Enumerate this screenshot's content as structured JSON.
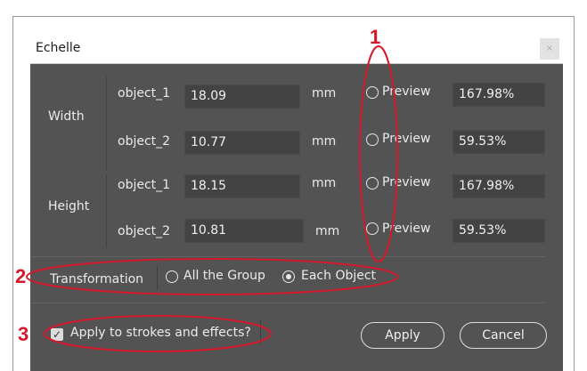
{
  "dialog": {
    "title": "Echelle",
    "close_glyph": "×"
  },
  "width_group": {
    "label": "Width",
    "rows": [
      {
        "object": "object_1",
        "value": "18.09",
        "unit": "mm",
        "preview": "Preview",
        "percent": "167.98%"
      },
      {
        "object": "object_2",
        "value": "10.77",
        "unit": "mm",
        "preview": "Preview",
        "percent": "59.53%"
      }
    ]
  },
  "height_group": {
    "label": "Height",
    "rows": [
      {
        "object": "object_1",
        "value": "18.15",
        "unit": "mm",
        "preview": "Preview",
        "percent": "167.98%"
      },
      {
        "object": "object_2",
        "value": "10.81",
        "unit": "mm",
        "preview": "Preview",
        "percent": "59.53%"
      }
    ]
  },
  "transformation": {
    "label": "Transformation",
    "options": [
      "All the Group",
      "Each Object"
    ],
    "selected": "Each Object"
  },
  "strokes_checkbox": {
    "label": "Apply to strokes and effects?",
    "checked": true,
    "check_glyph": "✓"
  },
  "buttons": {
    "apply": "Apply",
    "cancel": "Cancel"
  },
  "annotations": {
    "marker_1": "1",
    "marker_2": "2",
    "marker_3": "3",
    "color": "#d5182b"
  }
}
